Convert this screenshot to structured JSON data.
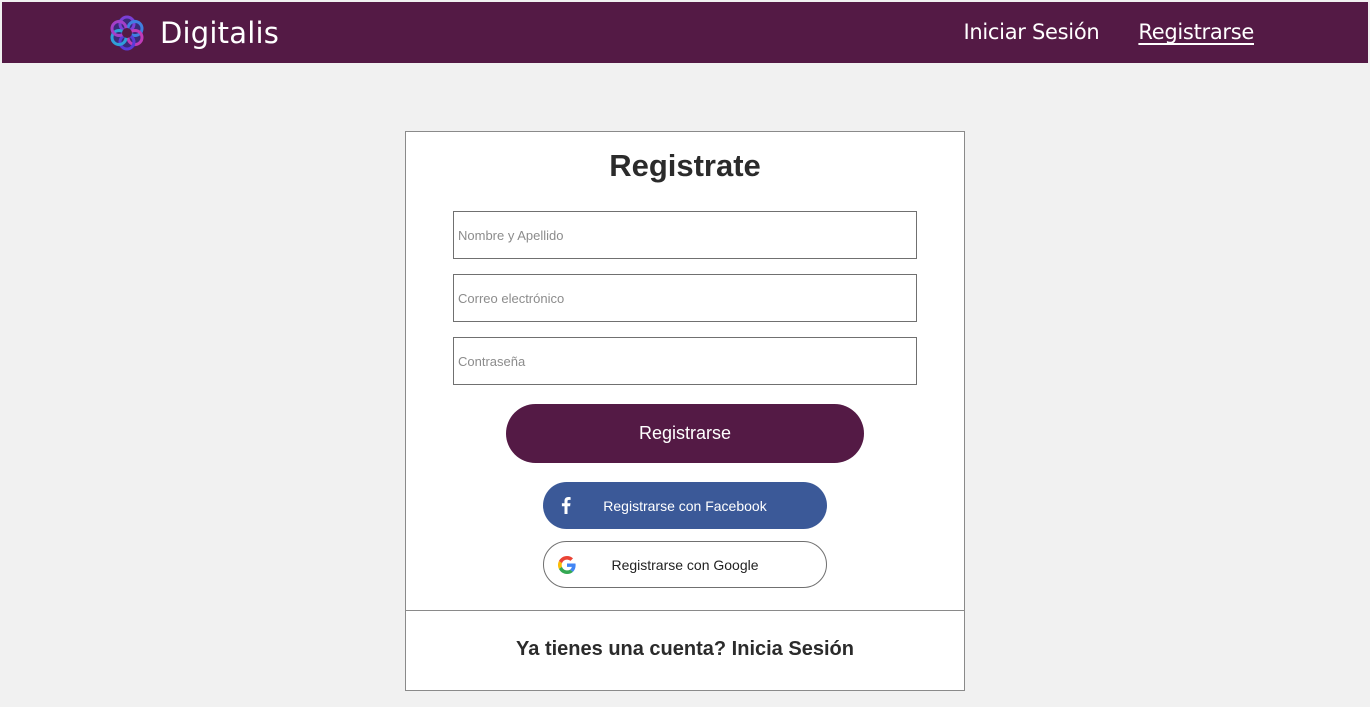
{
  "header": {
    "brand_name": "Digitalis",
    "logo_icon": "flower-logo-icon",
    "background_color": "#541a45",
    "nav": [
      {
        "label": "Iniciar Sesión",
        "active": false
      },
      {
        "label": "Registrarse",
        "active": true
      }
    ]
  },
  "form": {
    "title": "Registrate",
    "fields": {
      "name": {
        "placeholder": "Nombre y Apellido",
        "value": ""
      },
      "email": {
        "placeholder": "Correo electrónico",
        "value": ""
      },
      "password": {
        "placeholder": "Contraseña",
        "value": ""
      }
    },
    "submit_label": "Registrarse",
    "submit_color": "#541a45",
    "facebook": {
      "label": "Registrarse con Facebook",
      "icon": "facebook-icon",
      "color": "#3b5998"
    },
    "google": {
      "label": "Registrarse con Google",
      "icon": "google-icon"
    },
    "login_prompt": "Ya tienes una cuenta? Inicia Sesión"
  },
  "page_background": "#f1f1f1"
}
